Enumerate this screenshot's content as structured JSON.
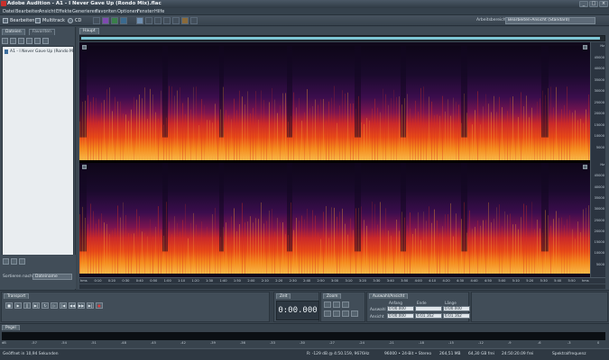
{
  "window": {
    "title": "Adobe Audition - A1 - I Never Gave Up (Rondo Mix).flac"
  },
  "menu": [
    "Datei",
    "Bearbeiten",
    "Ansicht",
    "Effekte",
    "Generieren",
    "Favoriten",
    "Optionen",
    "Fenster",
    "Hilfe"
  ],
  "toolbar": {
    "edit_label": "Bearbeiten",
    "multitrack_label": "Multitrack",
    "cd_label": "CD",
    "workspace_label": "Arbeitsbereich:",
    "workspace_value": "Bearbeiten-Ansicht (Standard)"
  },
  "left_panel": {
    "tabs": [
      "Dateien",
      "Favoriten"
    ],
    "file_item": "A1 - I Never Gave Up (Rondo Mi",
    "sort_label": "Sortieren nach:",
    "sort_value": "Dateiname"
  },
  "editor": {
    "tab": "Haupt",
    "freq_labels_top": [
      "Hz",
      "45000",
      "40000",
      "35000",
      "30000",
      "25000",
      "20000",
      "15000",
      "10000",
      "5000"
    ],
    "freq_labels_bottom": [
      "Hz",
      "45000",
      "40000",
      "35000",
      "30000",
      "25000",
      "20000",
      "15000",
      "10000",
      "5000"
    ],
    "time_labels": [
      "hms",
      "0:10",
      "0:20",
      "0:30",
      "0:40",
      "0:50",
      "1:00",
      "1:10",
      "1:20",
      "1:30",
      "1:40",
      "1:50",
      "2:00",
      "2:10",
      "2:20",
      "2:30",
      "2:40",
      "2:50",
      "3:00",
      "3:10",
      "3:20",
      "3:30",
      "3:40",
      "3:50",
      "4:00",
      "4:10",
      "4:20",
      "4:30",
      "4:40",
      "4:50",
      "5:00",
      "5:10",
      "5:20",
      "5:30",
      "5:40",
      "5:50",
      "hms"
    ],
    "overview_fill": 0.99
  },
  "transport": {
    "tab": "Transport"
  },
  "time": {
    "tab": "Zeit",
    "display": "0:00.000"
  },
  "zoom": {
    "tab": "Zoom"
  },
  "selection": {
    "tab": "Auswahl/Ansicht",
    "headers": [
      "Anfang",
      "Ende",
      "Länge"
    ],
    "rows": [
      {
        "label": "Auswahl",
        "start": "0:00.000",
        "end": "",
        "length": "0:00.000"
      },
      {
        "label": "Ansicht",
        "start": "0:00.000",
        "end": "6:01.162",
        "length": "6:01.162"
      }
    ]
  },
  "level": {
    "tab": "Pegel",
    "ticks": [
      "dB",
      "-57",
      "-54",
      "-51",
      "-48",
      "-45",
      "-42",
      "-39",
      "-36",
      "-33",
      "-30",
      "-27",
      "-24",
      "-21",
      "-18",
      "-15",
      "-12",
      "-9",
      "-6",
      "-3",
      "0"
    ]
  },
  "status": {
    "left": "Geöffnet in 10,94 Sekunden",
    "db": "R: -129 dB @ 4:50.159, 9676Hz",
    "format": "96000 • 24-Bit • Stereo",
    "size": "264,51 MB",
    "free": "64,30 GB frei",
    "duration": "24:50:20.09 frei",
    "mode": "Spektralfrequenz"
  },
  "colors": {
    "spectro_bg": "#10081b",
    "accent": "#7fc7d6"
  }
}
